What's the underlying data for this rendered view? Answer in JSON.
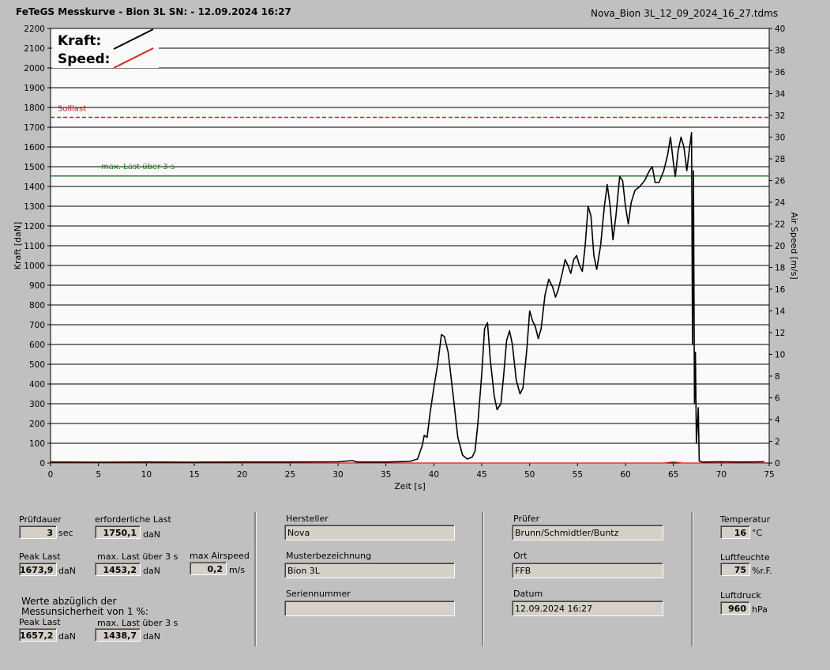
{
  "header": {
    "title": "FeTeGS Messkurve - Bion 3L  SN:  - 12.09.2024 16:27",
    "filename": "Nova_Bion 3L_12_09_2024_16_27.tdms"
  },
  "chart_data": {
    "type": "line",
    "xlabel": "Zeit [s]",
    "ylabel_left": "Kraft [daN]",
    "ylabel_right": "Air Speed [m/s]",
    "xlim": [
      0,
      75
    ],
    "ylim_left": [
      0,
      2200
    ],
    "ylim_right": [
      0,
      40
    ],
    "x_ticks": [
      0,
      5,
      10,
      15,
      20,
      25,
      30,
      35,
      40,
      45,
      50,
      55,
      60,
      65,
      70,
      75
    ],
    "y_left_ticks": [
      0,
      100,
      200,
      300,
      400,
      500,
      600,
      700,
      800,
      900,
      1000,
      1100,
      1200,
      1300,
      1400,
      1500,
      1600,
      1700,
      1800,
      1900,
      2000,
      2100,
      2200
    ],
    "y_right_ticks": [
      0,
      2,
      4,
      6,
      8,
      10,
      12,
      14,
      16,
      18,
      20,
      22,
      24,
      26,
      28,
      30,
      32,
      34,
      36,
      38,
      40
    ],
    "grid": true,
    "legend": [
      {
        "name": "Kraft:",
        "color": "#000000"
      },
      {
        "name": "Speed:",
        "color": "#e02020"
      }
    ],
    "reference_lines": [
      {
        "label": "Solllast",
        "value": 1750,
        "color": "#cc2020",
        "style": "dashed"
      },
      {
        "label": "max. Last über  3 s",
        "value": 1453,
        "color": "#2a7a2a",
        "style": "solid"
      }
    ],
    "series": [
      {
        "name": "Kraft:",
        "color": "#000000",
        "points": [
          [
            0,
            5
          ],
          [
            5,
            4
          ],
          [
            10,
            5
          ],
          [
            15,
            4
          ],
          [
            20,
            5
          ],
          [
            25,
            5
          ],
          [
            30,
            6
          ],
          [
            31.5,
            12
          ],
          [
            32,
            5
          ],
          [
            35,
            5
          ],
          [
            37.5,
            8
          ],
          [
            38.3,
            20
          ],
          [
            38.8,
            90
          ],
          [
            39,
            140
          ],
          [
            39.3,
            130
          ],
          [
            39.6,
            250
          ],
          [
            40,
            380
          ],
          [
            40.4,
            500
          ],
          [
            40.8,
            650
          ],
          [
            41.1,
            640
          ],
          [
            41.5,
            560
          ],
          [
            42,
            350
          ],
          [
            42.5,
            130
          ],
          [
            43,
            40
          ],
          [
            43.5,
            20
          ],
          [
            44,
            30
          ],
          [
            44.3,
            60
          ],
          [
            44.6,
            200
          ],
          [
            45,
            450
          ],
          [
            45.3,
            680
          ],
          [
            45.6,
            710
          ],
          [
            45.9,
            520
          ],
          [
            46.3,
            340
          ],
          [
            46.6,
            270
          ],
          [
            47,
            300
          ],
          [
            47.3,
            450
          ],
          [
            47.6,
            620
          ],
          [
            47.9,
            670
          ],
          [
            48.2,
            600
          ],
          [
            48.6,
            420
          ],
          [
            49,
            350
          ],
          [
            49.3,
            380
          ],
          [
            49.7,
            570
          ],
          [
            50,
            770
          ],
          [
            50.3,
            720
          ],
          [
            50.6,
            690
          ],
          [
            50.9,
            630
          ],
          [
            51.2,
            680
          ],
          [
            51.6,
            850
          ],
          [
            52,
            930
          ],
          [
            52.4,
            890
          ],
          [
            52.7,
            840
          ],
          [
            53,
            880
          ],
          [
            53.4,
            960
          ],
          [
            53.7,
            1030
          ],
          [
            54,
            1000
          ],
          [
            54.3,
            960
          ],
          [
            54.6,
            1030
          ],
          [
            54.9,
            1050
          ],
          [
            55.2,
            1000
          ],
          [
            55.5,
            970
          ],
          [
            55.8,
            1100
          ],
          [
            56.1,
            1300
          ],
          [
            56.4,
            1250
          ],
          [
            56.7,
            1050
          ],
          [
            57,
            980
          ],
          [
            57.4,
            1100
          ],
          [
            57.8,
            1300
          ],
          [
            58.1,
            1410
          ],
          [
            58.4,
            1300
          ],
          [
            58.7,
            1130
          ],
          [
            59,
            1250
          ],
          [
            59.4,
            1450
          ],
          [
            59.7,
            1430
          ],
          [
            60,
            1300
          ],
          [
            60.3,
            1210
          ],
          [
            60.6,
            1320
          ],
          [
            61,
            1380
          ],
          [
            61.5,
            1400
          ],
          [
            62,
            1430
          ],
          [
            62.5,
            1480
          ],
          [
            62.8,
            1500
          ],
          [
            63.1,
            1420
          ],
          [
            63.5,
            1420
          ],
          [
            64,
            1480
          ],
          [
            64.4,
            1560
          ],
          [
            64.7,
            1650
          ],
          [
            65,
            1520
          ],
          [
            65.2,
            1450
          ],
          [
            65.5,
            1580
          ],
          [
            65.8,
            1650
          ],
          [
            66.1,
            1600
          ],
          [
            66.4,
            1480
          ],
          [
            66.7,
            1600
          ],
          [
            66.9,
            1673
          ],
          [
            67,
            600
          ],
          [
            67.1,
            1480
          ],
          [
            67.2,
            300
          ],
          [
            67.3,
            560
          ],
          [
            67.4,
            100
          ],
          [
            67.6,
            280
          ],
          [
            67.7,
            10
          ],
          [
            68,
            5
          ],
          [
            70,
            6
          ],
          [
            72,
            5
          ],
          [
            74.5,
            6
          ]
        ]
      },
      {
        "name": "Speed:",
        "color": "#e02020",
        "points": [
          [
            0,
            0
          ],
          [
            64,
            0
          ],
          [
            65,
            0.1
          ],
          [
            66,
            0
          ],
          [
            74.5,
            0
          ]
        ]
      }
    ]
  },
  "panel": {
    "pruefdauer": {
      "label": "Prüfdauer",
      "value": "3",
      "unit": "sec"
    },
    "erforderliche_last": {
      "label": "erforderliche Last",
      "value": "1750,1",
      "unit": "daN"
    },
    "peak_last": {
      "label": "Peak Last",
      "value": "1673,9",
      "unit": "daN"
    },
    "max_last": {
      "label": "max. Last über  3 s",
      "value": "1453,2",
      "unit": "daN"
    },
    "max_airspeed": {
      "label": "max Airspeed",
      "value": "0,2",
      "unit": "m/s"
    },
    "werte_note": "Werte abzüglich der\nMessunsicherheit von 1  %:",
    "peak_last_2": {
      "label": "Peak Last",
      "value": "1657,2",
      "unit": "daN"
    },
    "max_last_2": {
      "label": "max. Last über  3 s",
      "value": "1438,7",
      "unit": "daN"
    },
    "hersteller": {
      "label": "Hersteller",
      "value": "Nova"
    },
    "musterbezeichnung": {
      "label": "Musterbezeichnung",
      "value": "Bion 3L"
    },
    "seriennummer": {
      "label": "Seriennummer",
      "value": ""
    },
    "pruefer": {
      "label": "Prüfer",
      "value": "Brunn/Schmidtler/Buntz"
    },
    "ort": {
      "label": "Ort",
      "value": "FFB"
    },
    "datum": {
      "label": "Datum",
      "value": "12.09.2024 16:27"
    },
    "temperatur": {
      "label": "Temperatur",
      "value": "16",
      "unit": "°C"
    },
    "luftfeuchte": {
      "label": "Luftfeuchte",
      "value": "75",
      "unit": "%r.F."
    },
    "luftdruck": {
      "label": "Luftdruck",
      "value": "960",
      "unit": "hPa"
    }
  }
}
